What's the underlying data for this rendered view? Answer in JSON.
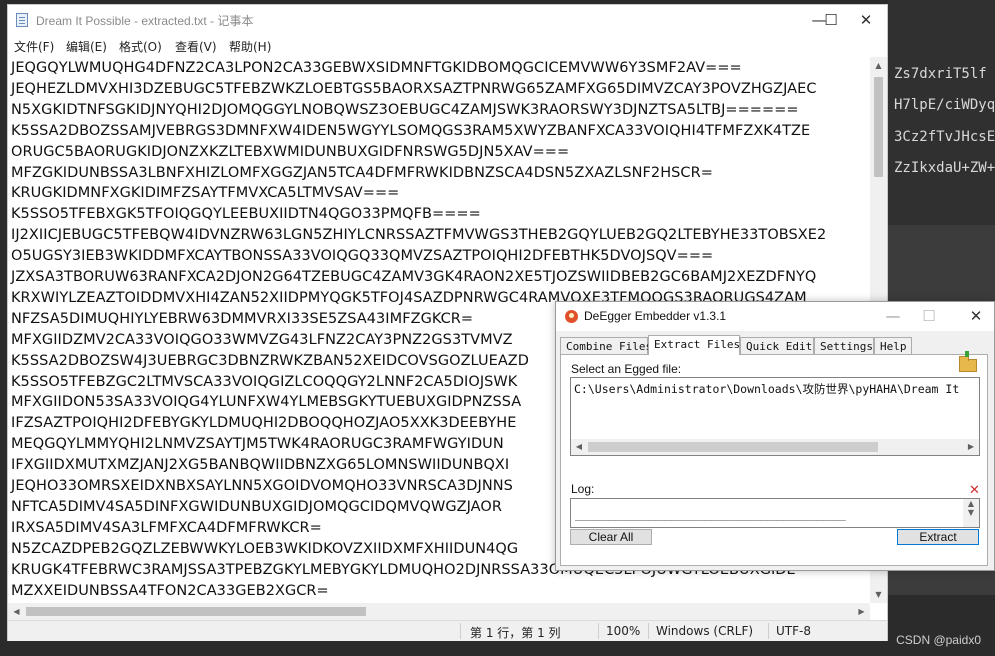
{
  "background_editor": {
    "lines": [
      "Zs7dxriT5lf",
      "H7lpE/ciWDyq",
      "3Cz2fTvJHcsE",
      "ZzIkxdaU+ZW+"
    ]
  },
  "watermark": "CSDN @paidx0",
  "notepad": {
    "title": "Dream It Possible - extracted.txt - 记事本",
    "window_controls": {
      "minimize": "—",
      "maximize": "☐",
      "close": "✕"
    },
    "menu": [
      "文件(F)",
      "编辑(E)",
      "格式(O)",
      "查看(V)",
      "帮助(H)"
    ],
    "text_lines": [
      "JEQGQYLWMUQHG4DFNZ2CA3LPON2CA33GEBWXSIDMNFTGKIDBOMQGCICEMVWW6Y3SMF2AV===",
      "JEQHEZLDMVXHI3DZEBUGC5TFEBZWKZLOEBTGS5BAORXSAZTPNRWG65ZAMFXG65DIMVZCAY3POVZHGZJAEC",
      "N5XGKIDTNFSGKIDJNYQHI2DJOMQGGYLNOBQWSZ3OEBUGC4ZAMJSWK3RAORSWY3DJNZTSA5LTBJ======",
      "K5SSA2DBOZSSAMJVEBRGS3DMNFXW4IDEN5WGYYLSOMQGS3RAM5XWYZBANFXCA33VOIQHI4TFMFZXK4TZE",
      "ORUGC5BAORUGKIDJONZXKZLTEBXWMIDUNBUXGIDFNRSWG5DJN5XAV===",
      "MFZGKIDUNBSSA3LBNFXHIZLOMFXGGZJAN5TCA4DFMFRWKIDBNZSCA4DSN5ZXAZLSNF2HSCR=",
      "KRUGKIDMNFXGKIDIMFZSAYTFMVXCA5LTMVSAV===",
      "K5SSO5TFEBXGK5TFOIQGQYLEEBUXIIDTN4QGO33PMQFB====",
      "IJ2XIICJEBUGC5TFEBQW4IDVNZRW63LGN5ZHIYLCNRSSAZTFMVWGS3THEB2GQYLUEB2GQ2LTEBYHE33TOBSXE2",
      "O5UGSY3IEB3WKIDDMFXCAYTBONSSA33VOIQGQ33QMVZSAZTPOIQHI2DFEBTHK5DVOJSQV===",
      "JZXSA3TBORUW63RANFXCA2DJON2G64TZEBUGC4ZAMV3GK4RAON2XE5TJOZSWIIDBEB2GC6BAMJ2XEZDFNYQ",
      "KRXWIYLZEAZTOIDDMVXHI4ZAN52XIIDPMYQGK5TFOJ4SAZDPNRWGC4RAMVQXE3TFMQQGS3RAORUGS4ZAM",
      "NFZSA5DIMUQHIYLYEBRW63DMMVRXI33SE5ZSA43IMFZGKCR=",
      "MFXGIIDZMV2CA33VOIQGO33WMVZG43LFNZ2CAY3PNZ2GS3TVMVZ",
      "K5SSA2DBOZSW4J3UEBRGC3DBNZRWKZBAN52XEIDCOVSGOZLUEAZD",
      "K5SSO5TFEBZGC2LTMVSCA33VOIQGIZLCOQQGY2LNNF2CA5DIOJSWK",
      "MFXGIIDON53SA33VOIQG4YLUNFXW4YLMEBSGKYTUEBUXGIDPNZSSA",
      "IFZSAZTPOIQHI2DFEBYGKYLDMUQHI2DBOQQHOZJAO5XXK3DEEBYHE",
      "MEQGQYLMMYQHI2LNMVZSAYTJM5TWK4RAORUGC3RAMFWGYIDUN",
      "IFXGIIDXMUTXMZJANJ2XG5BANBQWIIDBNZXG65LOMNSWIIDUNBQXI",
      "JEQHO33OMRSXEIDXNBXSAYLNN5XGOIDVOMQHO33VNRSCA3DJNNS",
      "NFTCA5DIMV4SA5DINFXGWIDUNBUXGIDJOMQGCIDQMVQWGZJAOR",
      "IRXSA5DIMV4SA3LFMFXCA4DFMFRWKCR=",
      "N5ZCAZDPEB2GQZLZEBWWKYLOEB3WKIDKOVZXIIDXMFXHIIDUN4QG",
      "KRUGK4TFEBRWC3RAMJSSA3TPEBZGKYLMEBYGKYLDMUQHO2DJNRSSA33OMUQEC5LPOJUWGYLOEBUXGIDE",
      "MZXXEIDUNBSSA4TFON2CA33GEB2XGCR="
    ],
    "status": {
      "position": "第 1 行，第 1 列",
      "zoom": "100%",
      "line_ending": "Windows (CRLF)",
      "encoding": "UTF-8"
    }
  },
  "degger": {
    "title": "DeEgger Embedder v1.3.1",
    "window_controls": {
      "minimize": "—",
      "maximize": "☐",
      "close": "✕"
    },
    "tabs": [
      "Combine Files",
      "Extract Files",
      "Quick Edit",
      "Settings",
      "Help"
    ],
    "active_tab": "Extract Files",
    "select_label": "Select an Egged file:",
    "file_path": "C:\\Users\\Administrator\\Downloads\\攻防世界\\pyHAHA\\Dream It",
    "log_label": "Log:",
    "log_text": "________________________________________________",
    "clear_button": "Clear All",
    "extract_button": "Extract",
    "clear_log_icon": "✕"
  }
}
